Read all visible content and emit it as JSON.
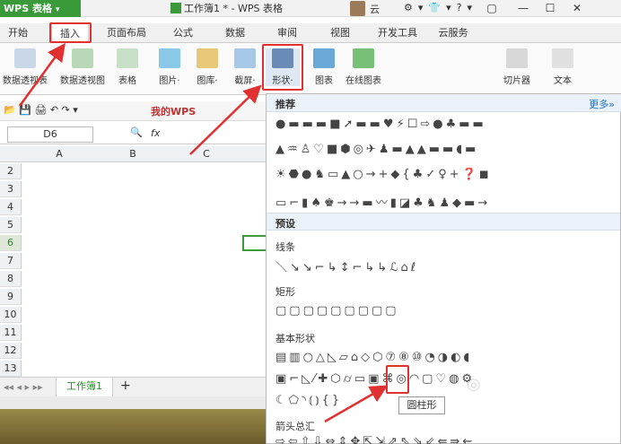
{
  "app": {
    "logo": "WPS 表格",
    "title": "工作簿1 * - WPS 表格",
    "user": "云"
  },
  "window_buttons": [
    "▢",
    "—",
    "☐",
    "✕"
  ],
  "menu": {
    "items": [
      "开始",
      "插入",
      "页面布局",
      "公式",
      "数据",
      "审阅",
      "视图",
      "开发工具",
      "云服务"
    ],
    "active": "插入"
  },
  "ribbon": {
    "buttons": [
      "数据透视表",
      "数据透视图",
      "表格",
      "图片·",
      "图库·",
      "截屏·",
      "形状·",
      "图表",
      "在线图表",
      "切片器",
      "文本"
    ]
  },
  "quick_access": {
    "my_wps": "我的WPS"
  },
  "formula_bar": {
    "name_box": "D6",
    "fx": "fx"
  },
  "columns": [
    "A",
    "B",
    "C"
  ],
  "rows": [
    "2",
    "3",
    "4",
    "5",
    "6",
    "7",
    "8",
    "9",
    "10",
    "11",
    "12",
    "13"
  ],
  "selected_row": "6",
  "sheet_tab": "工作簿1",
  "add_sheet": "+",
  "shapes_panel": {
    "recommended": "推荐",
    "more": "更多»",
    "preset": "预设",
    "lines": "线条",
    "rectangles": "矩形",
    "basic_shapes": "基本形状",
    "block_arrows": "箭头总汇"
  },
  "tooltip": "圆柱形",
  "highlight_color": "#e03030",
  "accent_color": "#3a9a3a"
}
